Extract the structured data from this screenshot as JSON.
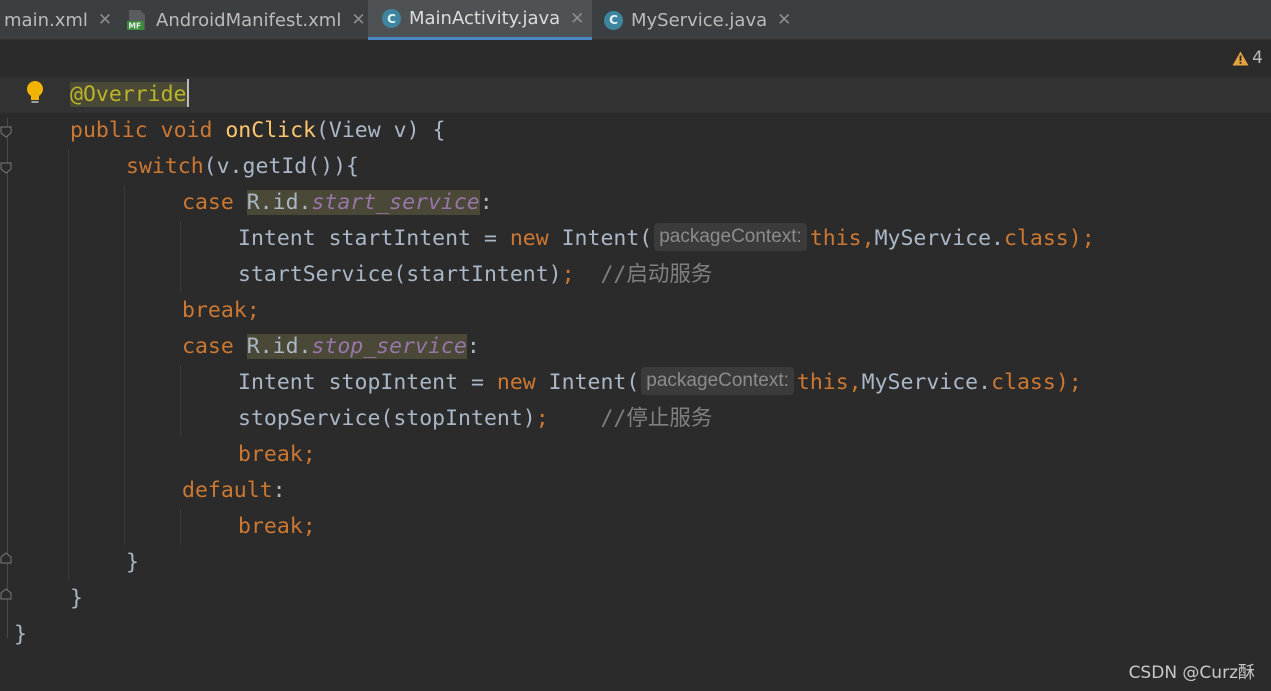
{
  "tabs": [
    {
      "label": "main.xml",
      "icon": "xml-file-icon",
      "active": false
    },
    {
      "label": "AndroidManifest.xml",
      "icon": "manifest-file-icon",
      "icon_text": "MF",
      "active": false
    },
    {
      "label": "MainActivity.java",
      "icon": "java-class-icon",
      "icon_text": "C",
      "active": true
    },
    {
      "label": "MyService.java",
      "icon": "java-class-icon",
      "icon_text": "C",
      "active": false
    }
  ],
  "tab_close_glyph": "✕",
  "editor": {
    "warning_count": "4",
    "inlay_hint": "packageContext:",
    "lines": {
      "l1": {
        "annotation": "@Override"
      },
      "l2": {
        "kw1": "public",
        "kw2": "void",
        "fn": "onClick",
        "rest": "(View v) {"
      },
      "l3": {
        "kw": "switch",
        "rest": "(v.getId()){"
      },
      "l4": {
        "kw": "case",
        "ref": "R.id.",
        "field": "start_service",
        "rest": ":"
      },
      "l5": {
        "pre": "Intent startIntent = ",
        "kw": "new",
        "mid": " Intent(",
        "kw2": "this",
        "comma": ",",
        "cls": "MyService.",
        "kw3": "class",
        "end": ");"
      },
      "l6": {
        "code": "startService(startIntent)",
        "semi": ";",
        "comment": "//启动服务"
      },
      "l7": {
        "kw": "break;"
      },
      "l8": {
        "kw": "case",
        "ref": "R.id.",
        "field": "stop_service",
        "rest": ":"
      },
      "l9": {
        "pre": "Intent stopIntent = ",
        "kw": "new",
        "mid": " Intent(",
        "kw2": "this",
        "comma": ",",
        "cls": "MyService.",
        "kw3": "class",
        "end": ");"
      },
      "l10": {
        "code": "stopService(stopIntent)",
        "semi": ";",
        "comment": "//停止服务"
      },
      "l11": {
        "kw": "break;"
      },
      "l12": {
        "kw": "default",
        "rest": ":"
      },
      "l13": {
        "kw": "break;"
      },
      "l14": {
        "text": "}"
      },
      "l15": {
        "text": "}"
      },
      "l16": {
        "text": "}"
      }
    }
  },
  "watermark": "CSDN @Curz酥",
  "colors": {
    "keyword": "#cc7832",
    "function": "#ffc66d",
    "annotation": "#bbb529",
    "field": "#9876aa",
    "comment": "#808080",
    "text": "#a9b7c6",
    "tab_active_underline": "#4a88c7"
  }
}
